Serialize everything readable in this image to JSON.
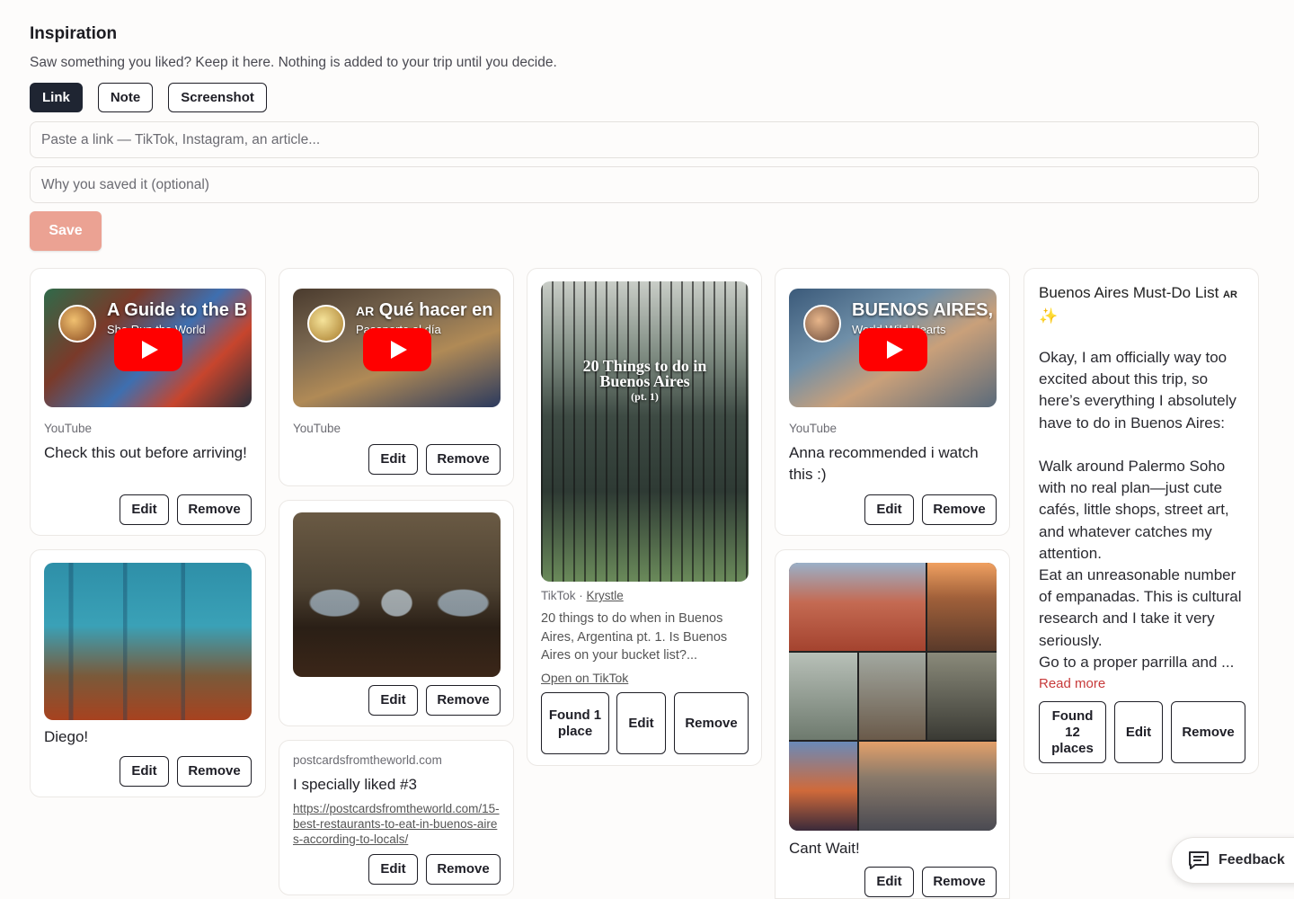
{
  "header": {
    "title": "Inspiration",
    "subtitle": "Saw something you liked? Keep it here. Nothing is added to your trip until you decide."
  },
  "type_toggle": {
    "link": "Link",
    "note": "Note",
    "screenshot": "Screenshot",
    "active": "Link"
  },
  "form": {
    "link_placeholder": "Paste a link — TikTok, Instagram, an article...",
    "why_placeholder": "Why you saved it (optional)",
    "save_label": "Save"
  },
  "actions": {
    "edit": "Edit",
    "remove": "Remove"
  },
  "cards": {
    "yt1": {
      "video_title": "A Guide to the B",
      "channel": "She Run the World",
      "source": "YouTube",
      "note": "Check this out before arriving!"
    },
    "yt2": {
      "flag": "AR",
      "video_title": "Qué hacer en",
      "channel": "Pasaporte al día",
      "source": "YouTube"
    },
    "yt3": {
      "video_title": "BUENOS AIRES,",
      "channel": "World Wild Hearts",
      "source": "YouTube",
      "note": "Anna recommended i watch this :)"
    },
    "diego": {
      "note": "Diego!"
    },
    "room": {},
    "tiktok": {
      "overlay_line1": "20 Things to do in",
      "overlay_line2": "Buenos Aires",
      "overlay_line3": "(pt. 1)",
      "source_prefix": "TikTok · ",
      "author": "Krystle",
      "description": "20 things to do when in Buenos Aires, Argentina pt. 1. Is Buenos Aires on your bucket list?...",
      "open_link": "Open on TikTok",
      "found": "Found 1 place"
    },
    "postcards": {
      "source": "postcardsfromtheworld.com",
      "note": "I specially liked #3",
      "url": "https://postcardsfromtheworld.com/15-best-restaurants-to-eat-in-buenos-aires-according-to-locals/"
    },
    "collage": {
      "note": "Cant Wait!"
    },
    "must_do": {
      "title": "Buenos Aires Must-Do List",
      "flag": "AR",
      "sparkle": "✨",
      "body": "Okay, I am officially way too excited about this trip, so here’s everything I absolutely have to do in Buenos Aires:\n\nWalk around Palermo Soho with no real plan—just cute cafés, little shops, street art, and whatever catches my attention.\nEat an unreasonable number of empanadas. This is cultural research and I take it very seriously.\nGo to a proper parrilla and ...",
      "read_more": "Read more",
      "found": "Found 12 places"
    }
  },
  "feedback": {
    "label": "Feedback"
  }
}
